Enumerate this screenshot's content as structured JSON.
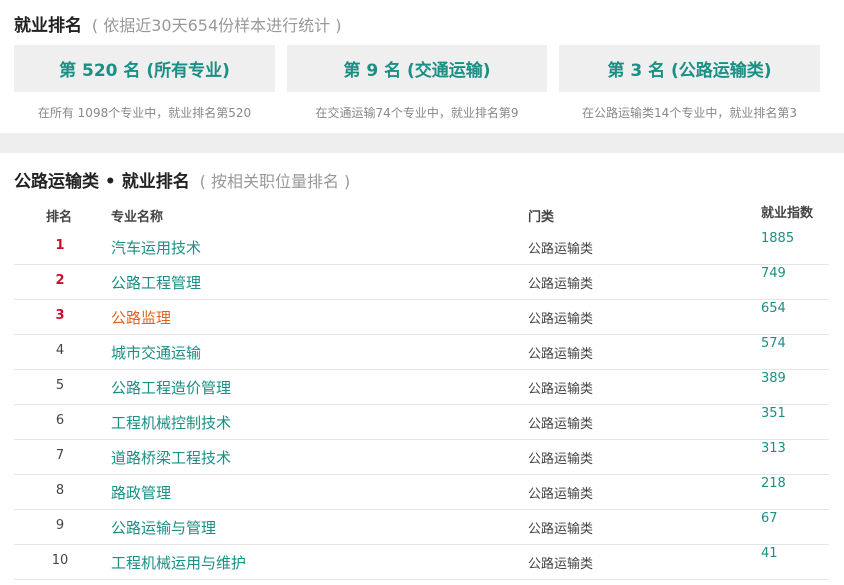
{
  "overview": {
    "title": "就业排名",
    "subtitle": "( 依据近30天654份样本进行统计 )",
    "cards": [
      {
        "label": "第 520 名 (所有专业)",
        "desc": "在所有 1098个专业中，就业排名第520"
      },
      {
        "label": "第 9 名 (交通运输)",
        "desc": "在交通运输74个专业中，就业排名第9"
      },
      {
        "label": "第 3 名 (公路运输类)",
        "desc": "在公路运输类14个专业中，就业排名第3"
      }
    ]
  },
  "ranking": {
    "title": "公路运输类 • 就业排名",
    "subtitle": "( 按相关职位量排名 )",
    "headers": {
      "rank": "排名",
      "name": "专业名称",
      "category": "门类",
      "index": "就业指数"
    },
    "rows": [
      {
        "rank": "1",
        "name": "汽车运用技术",
        "category": "公路运输类",
        "index": "1885"
      },
      {
        "rank": "2",
        "name": "公路工程管理",
        "category": "公路运输类",
        "index": "749"
      },
      {
        "rank": "3",
        "name": "公路监理",
        "category": "公路运输类",
        "index": "654"
      },
      {
        "rank": "4",
        "name": "城市交通运输",
        "category": "公路运输类",
        "index": "574"
      },
      {
        "rank": "5",
        "name": "公路工程造价管理",
        "category": "公路运输类",
        "index": "389"
      },
      {
        "rank": "6",
        "name": "工程机械控制技术",
        "category": "公路运输类",
        "index": "351"
      },
      {
        "rank": "7",
        "name": "道路桥梁工程技术",
        "category": "公路运输类",
        "index": "313"
      },
      {
        "rank": "8",
        "name": "路政管理",
        "category": "公路运输类",
        "index": "218"
      },
      {
        "rank": "9",
        "name": "公路运输与管理",
        "category": "公路运输类",
        "index": "67"
      },
      {
        "rank": "10",
        "name": "工程机械运用与维护",
        "category": "公路运输类",
        "index": "41"
      }
    ]
  },
  "colors": {
    "accent": "#1a8f85",
    "top_rank": "#c8102e",
    "current_major": "#e0641d",
    "card_bg": "#efefef"
  }
}
